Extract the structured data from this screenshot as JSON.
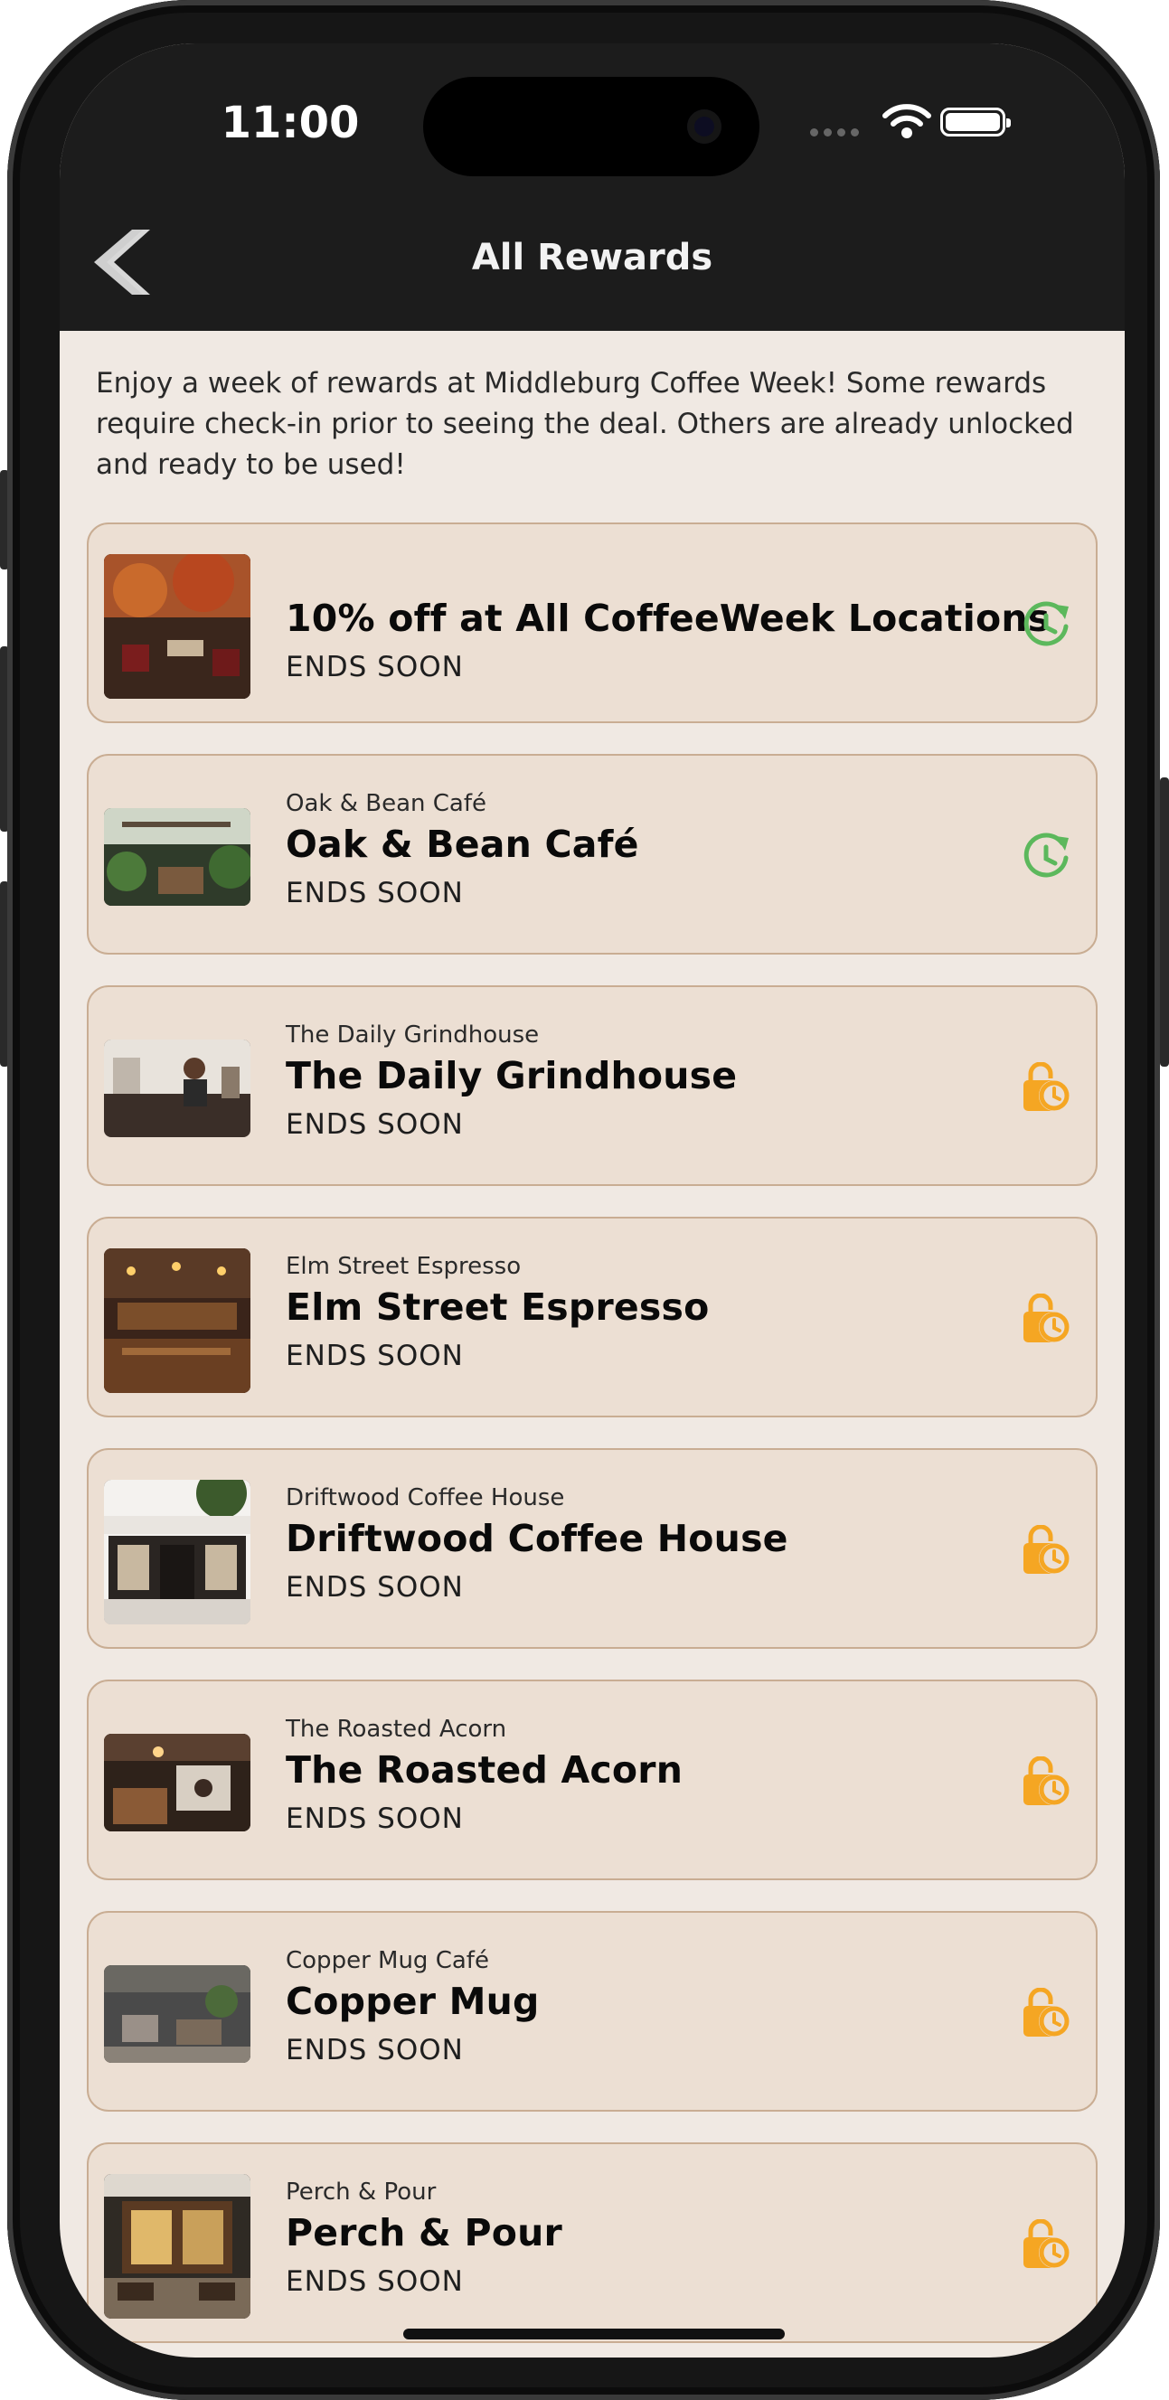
{
  "status_bar": {
    "time": "11:00"
  },
  "header": {
    "title": "All Rewards"
  },
  "intro_text": "Enjoy a week of rewards at Middleburg Coffee Week! Some rewards require check-in prior to seeing the deal. Others are already unlocked and ready to be used!",
  "colors": {
    "header_bg": "#1c1c1c",
    "page_bg": "#f0e9e3",
    "card_bg": "#ecdfd3",
    "card_border": "#c9ad93",
    "unlocked_icon": "#5cb85c",
    "locked_icon": "#f5a623"
  },
  "rewards": [
    {
      "subtitle": "",
      "title": "10% off at All CoffeeWeek Locations",
      "status_text": "ENDS SOON",
      "icon": "refresh-clock-icon"
    },
    {
      "subtitle": "Oak & Bean Café",
      "title": "Oak & Bean Café",
      "status_text": "ENDS SOON",
      "icon": "refresh-clock-icon"
    },
    {
      "subtitle": "The Daily Grindhouse",
      "title": "The Daily Grindhouse",
      "status_text": "ENDS SOON",
      "icon": "lock-clock-icon"
    },
    {
      "subtitle": "Elm Street Espresso",
      "title": "Elm Street Espresso",
      "status_text": "ENDS SOON",
      "icon": "lock-clock-icon"
    },
    {
      "subtitle": "Driftwood Coffee House",
      "title": "Driftwood Coffee House",
      "status_text": "ENDS SOON",
      "icon": "lock-clock-icon"
    },
    {
      "subtitle": "The Roasted Acorn",
      "title": "The Roasted Acorn",
      "status_text": "ENDS SOON",
      "icon": "lock-clock-icon"
    },
    {
      "subtitle": "Copper Mug Café",
      "title": "Copper Mug",
      "status_text": "ENDS SOON",
      "icon": "lock-clock-icon"
    },
    {
      "subtitle": "Perch & Pour",
      "title": "Perch & Pour",
      "status_text": "ENDS SOON",
      "icon": "lock-clock-icon"
    }
  ]
}
